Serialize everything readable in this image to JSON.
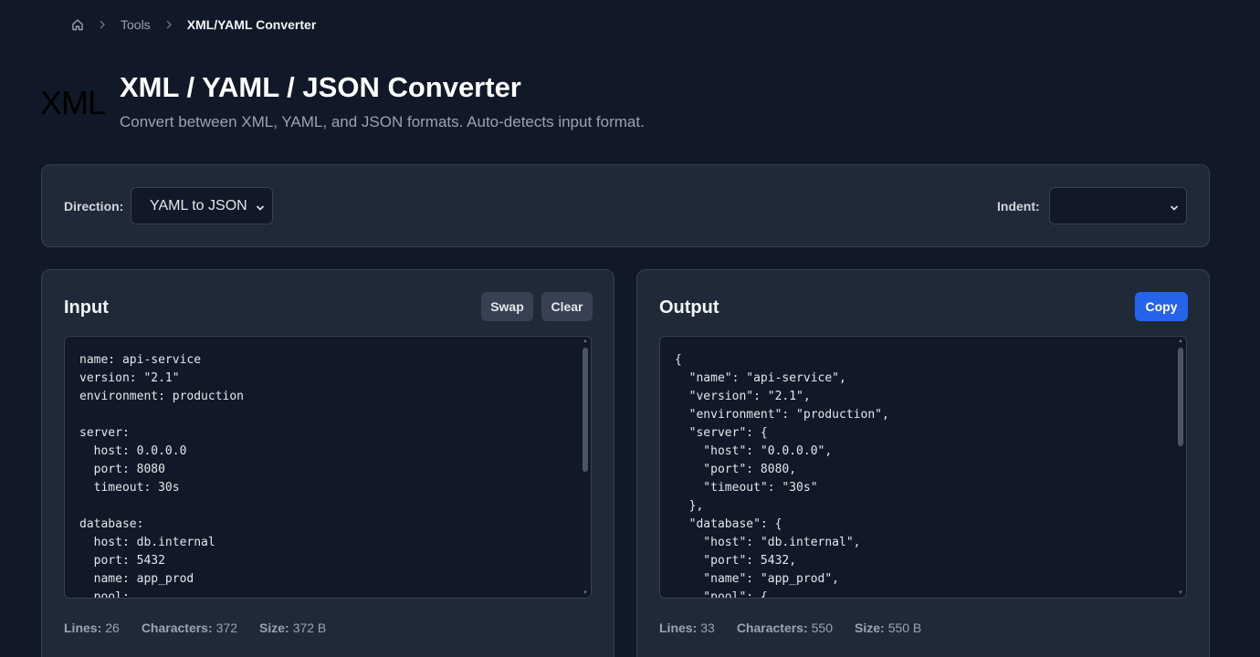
{
  "breadcrumb": {
    "home_icon": "home-icon",
    "items": [
      "Tools",
      "XML/YAML Converter"
    ]
  },
  "hero": {
    "icon_text": "XML",
    "title": "XML / YAML / JSON Converter",
    "subtitle": "Convert between XML, YAML, and JSON formats. Auto-detects input format."
  },
  "options": {
    "direction_label": "Direction:",
    "direction_value": "YAML to JSON",
    "indent_label": "Indent:",
    "indent_value": ""
  },
  "input": {
    "title": "Input",
    "swap_label": "Swap",
    "clear_label": "Clear",
    "content": "name: api-service\nversion: \"2.1\"\nenvironment: production\n\nserver:\n  host: 0.0.0.0\n  port: 8080\n  timeout: 30s\n\ndatabase:\n  host: db.internal\n  port: 5432\n  name: app_prod\n  pool:",
    "stats": {
      "lines_label": "Lines:",
      "lines": "26",
      "chars_label": "Characters:",
      "chars": "372",
      "size_label": "Size:",
      "size": "372 B"
    }
  },
  "output": {
    "title": "Output",
    "copy_label": "Copy",
    "content": "{\n  \"name\": \"api-service\",\n  \"version\": \"2.1\",\n  \"environment\": \"production\",\n  \"server\": {\n    \"host\": \"0.0.0.0\",\n    \"port\": 8080,\n    \"timeout\": \"30s\"\n  },\n  \"database\": {\n    \"host\": \"db.internal\",\n    \"port\": 5432,\n    \"name\": \"app_prod\",\n    \"pool\": {",
    "stats": {
      "lines_label": "Lines:",
      "lines": "33",
      "chars_label": "Characters:",
      "chars": "550",
      "size_label": "Size:",
      "size": "550 B"
    }
  },
  "colors": {
    "background": "#111827",
    "panel": "#1f2937",
    "accent": "#2563eb"
  }
}
